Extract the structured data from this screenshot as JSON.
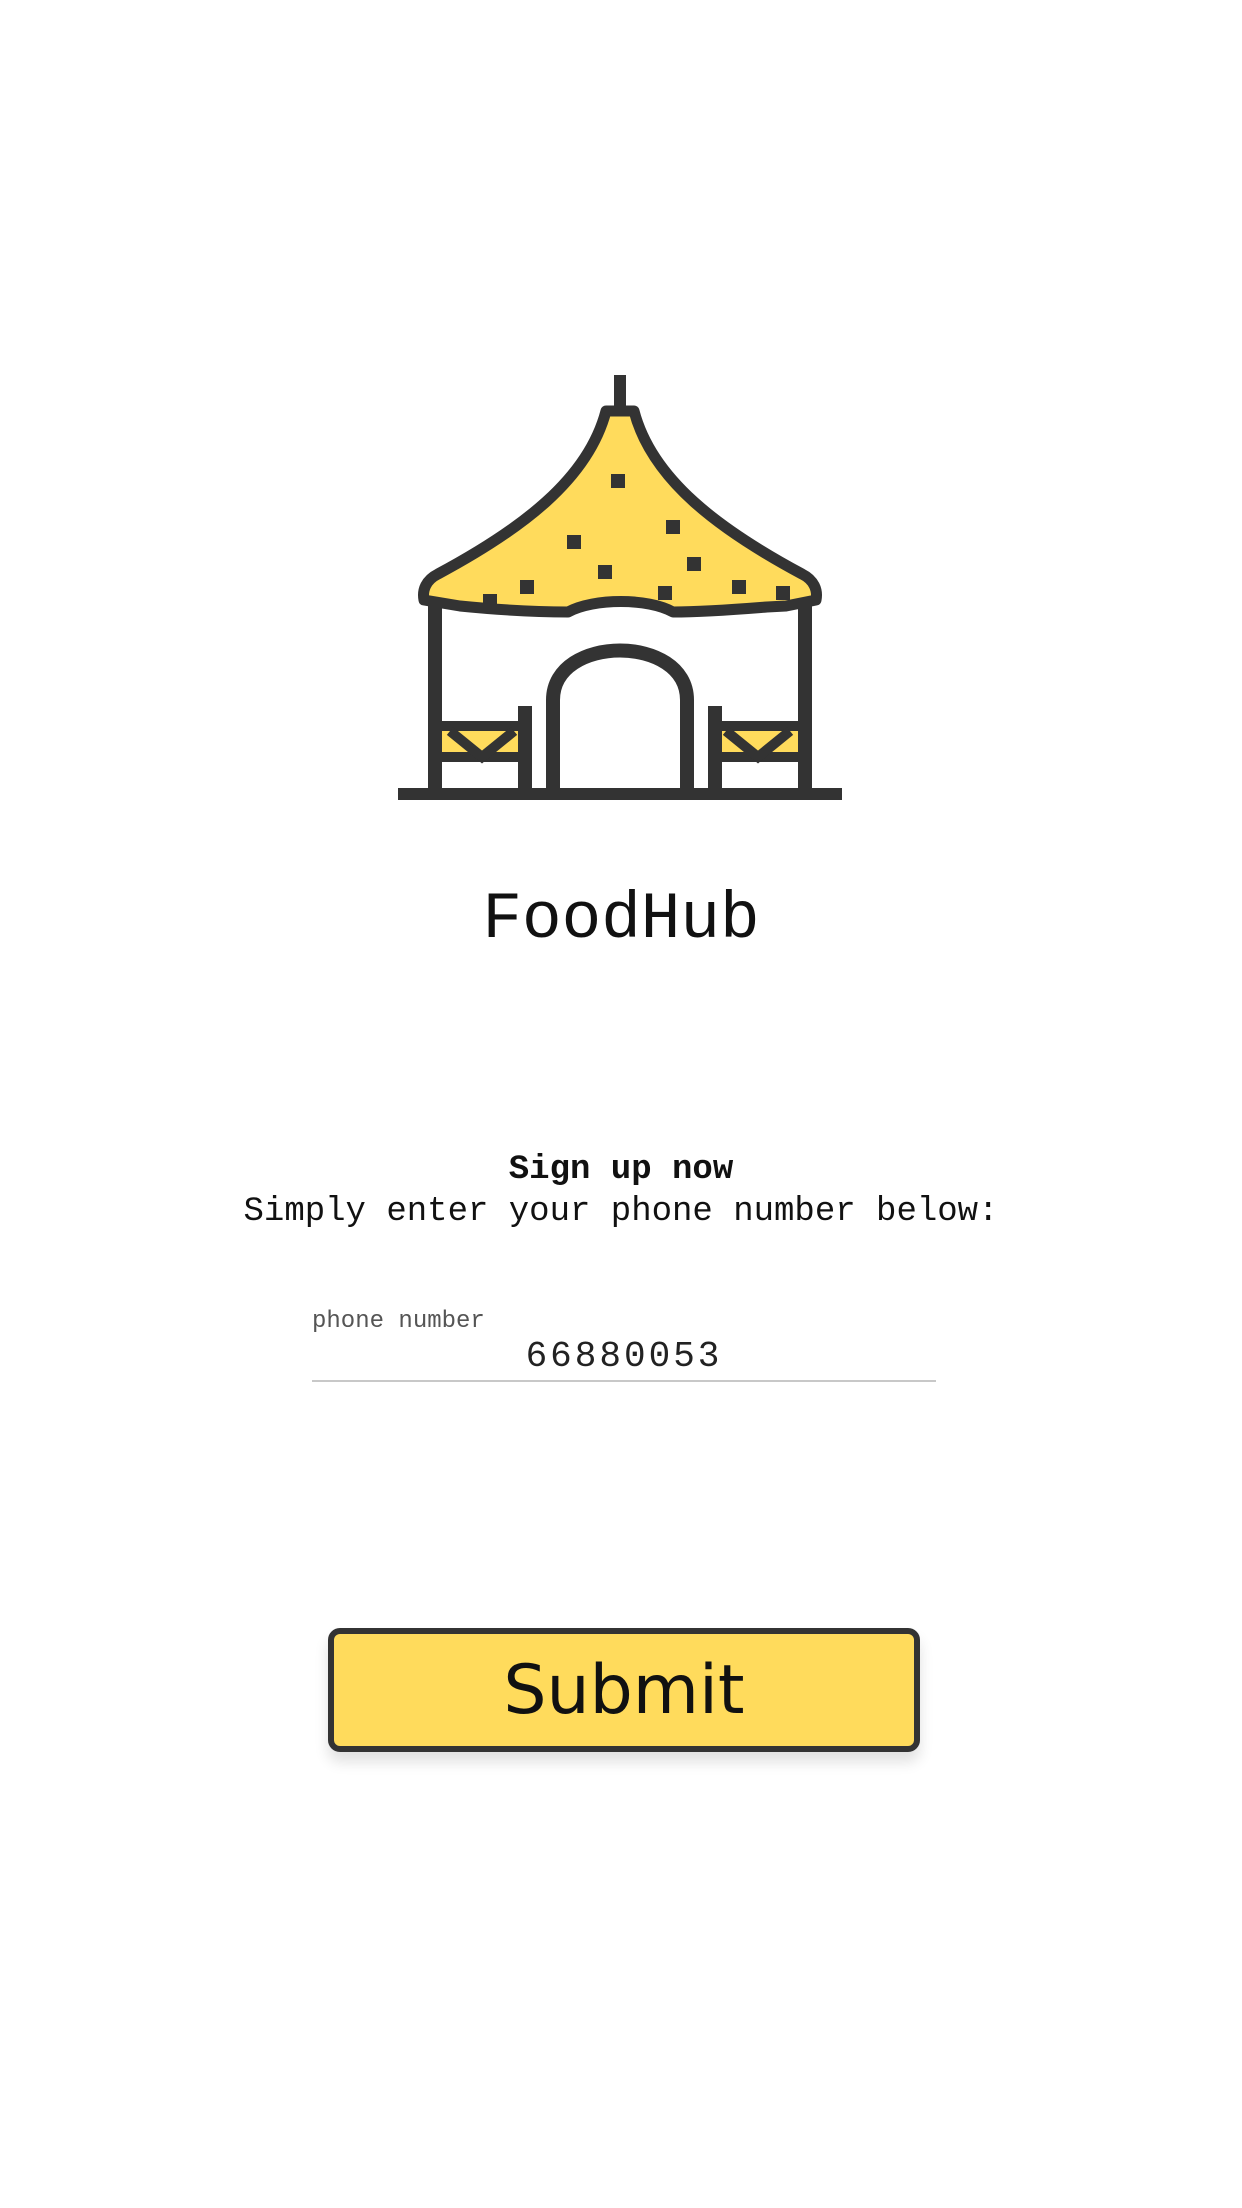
{
  "logo": {
    "icon": "hut-icon",
    "colors": {
      "roof_fill": "#ffdb5c",
      "outline": "#333333"
    }
  },
  "app": {
    "title": "FoodHub"
  },
  "signup": {
    "heading": "Sign up now",
    "subheading": "Simply enter your phone number below:"
  },
  "phone": {
    "label": "phone number",
    "value": "66880053"
  },
  "submit": {
    "label": "Submit",
    "color": "#ffdb5c",
    "border_color": "#333333"
  }
}
